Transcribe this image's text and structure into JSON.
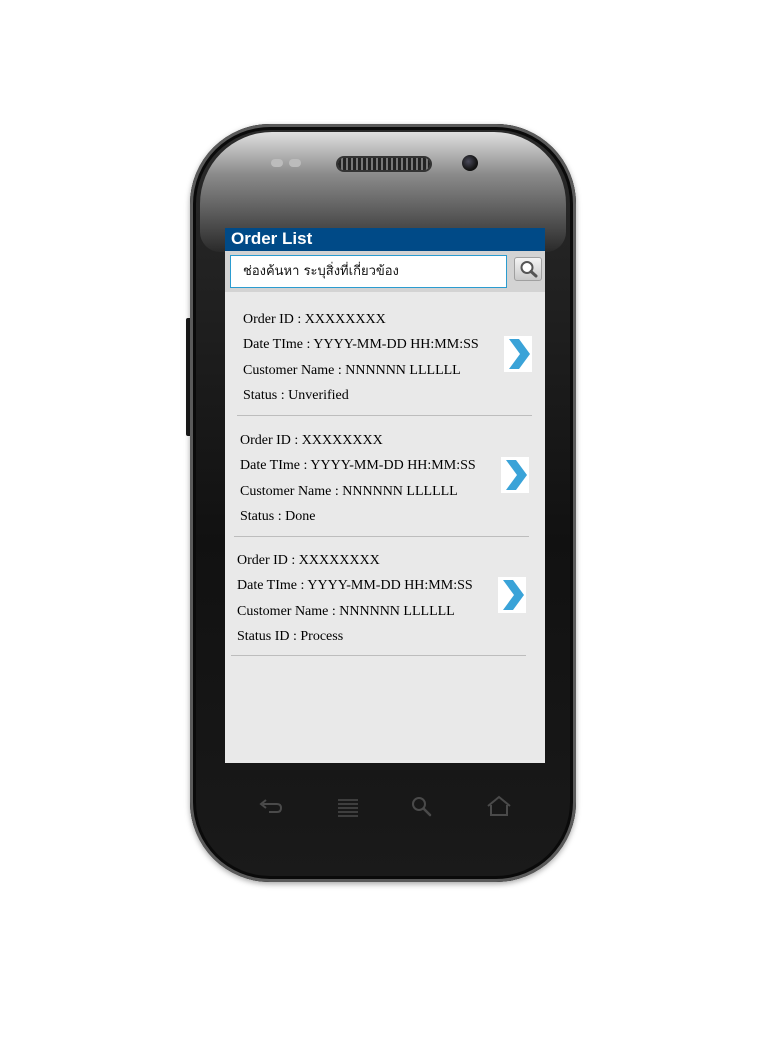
{
  "app": {
    "title": "Order List"
  },
  "search": {
    "value": "ช่องค้นหา ระบุสิ่งที่เกี่ยวข้อง",
    "button_icon": "search-icon"
  },
  "orders": [
    {
      "id_line": "Order ID : XXXXXXXX",
      "datetime_line": "Date TIme : YYYY-MM-DD  HH:MM:SS",
      "customer_line": "Customer Name  :  NNNNNN LLLLLL",
      "status_line": "Status : Unverified"
    },
    {
      "id_line": "Order ID : XXXXXXXX",
      "datetime_line": "Date TIme : YYYY-MM-DD  HH:MM:SS",
      "customer_line": "Customer Name  :  NNNNNN LLLLLL",
      "status_line": "Status  : Done"
    },
    {
      "id_line": "Order ID : XXXXXXXX",
      "datetime_line": "Date TIme : YYYY-MM-DD  HH:MM:SS",
      "customer_line": "Customer Name  :  NNNNNN LLLLLL",
      "status_line": "Status ID : Process"
    }
  ],
  "nav_keys": [
    "back-icon",
    "menu-icon",
    "search-icon",
    "home-icon"
  ],
  "colors": {
    "title_bar": "#004a87",
    "screen_bg": "#e9e9e9",
    "chevron": "#3aa3d8",
    "search_border": "#2b9cd0"
  }
}
